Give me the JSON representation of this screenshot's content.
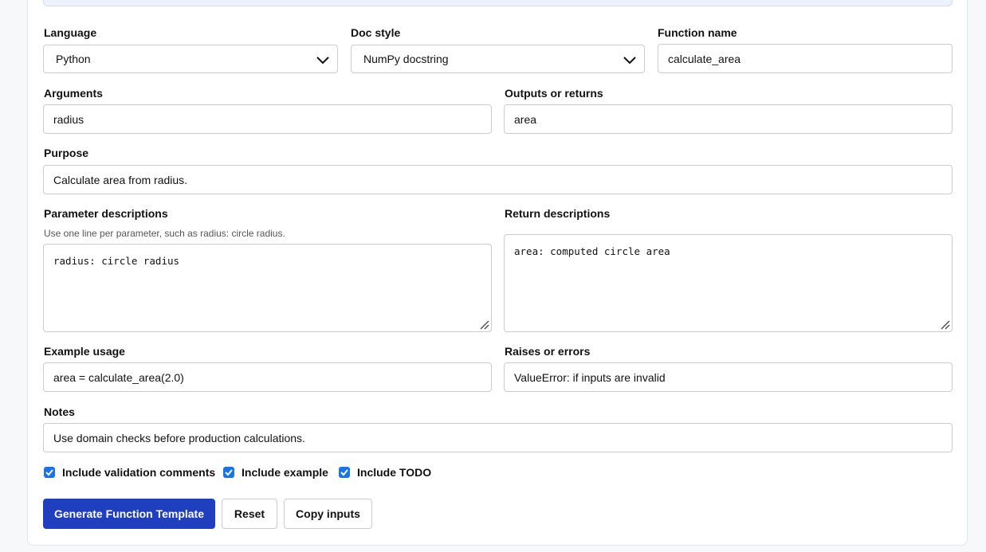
{
  "form": {
    "language": {
      "label": "Language",
      "value": "Python"
    },
    "doc_style": {
      "label": "Doc style",
      "value": "NumPy docstring"
    },
    "function_name": {
      "label": "Function name",
      "value": "calculate_area"
    },
    "arguments": {
      "label": "Arguments",
      "value": "radius"
    },
    "outputs": {
      "label": "Outputs or returns",
      "value": "area"
    },
    "purpose": {
      "label": "Purpose",
      "value": "Calculate area from radius."
    },
    "param_desc": {
      "label": "Parameter descriptions",
      "help": "Use one line per parameter, such as radius: circle radius.",
      "value": "radius: circle radius"
    },
    "return_desc": {
      "label": "Return descriptions",
      "value": "area: computed circle area"
    },
    "example": {
      "label": "Example usage",
      "value": "area = calculate_area(2.0)"
    },
    "raises": {
      "label": "Raises or errors",
      "value": "ValueError: if inputs are invalid"
    },
    "notes": {
      "label": "Notes",
      "value": "Use domain checks before production calculations."
    }
  },
  "options": [
    {
      "label": "Include validation comments",
      "checked": true
    },
    {
      "label": "Include example",
      "checked": true
    },
    {
      "label": "Include TODO",
      "checked": true
    }
  ],
  "buttons": {
    "generate": "Generate Function Template",
    "reset": "Reset",
    "copy": "Copy inputs"
  },
  "colors": {
    "primary": "#1f3fbf",
    "checkbox": "#1a73e8",
    "banner": "#eef4ff"
  }
}
